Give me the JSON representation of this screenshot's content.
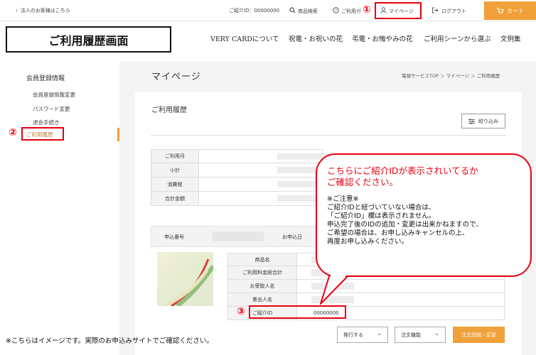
{
  "topbar": {
    "corp_link": "法人のお客様はこちら",
    "referral_id": "ご紹介ID：00000000",
    "search": "商品検索",
    "help": "ご利用ガ",
    "mypage": "マイページ",
    "logout": "ログアウト",
    "cart": "カート",
    "mark": "①"
  },
  "header": {
    "page_title": "ご利用履歴画面",
    "nav": [
      "VERY CARDについて",
      "祝電・お祝いの花",
      "弔電・お悔やみの花",
      "ご利用シーンから選ぶ",
      "文例集"
    ]
  },
  "sidebar": {
    "heading": "会員登録情報",
    "items": [
      {
        "label": "会員登録情報変更"
      },
      {
        "label": "パスワード変更"
      },
      {
        "label": "退会手続き"
      },
      {
        "label": "ご利用履歴"
      }
    ],
    "mark": "②"
  },
  "main": {
    "title": "マイページ",
    "breadcrumb": "電報サービスTOP ＞ マイページ ＞ ご利用履歴",
    "section_title": "ご利用履歴",
    "filter_button": "絞り込み",
    "summary_labels": [
      "ご利用月",
      "小計",
      "消費税",
      "合計金額"
    ],
    "order_no_label": "申込番号",
    "order_date_label": "お申込日",
    "detail_labels": [
      "商品名",
      "ご利用料金総合計",
      "お受取人名",
      "差出人名",
      "ご紹介ID"
    ],
    "referral_id_value": "00000000",
    "mark": "③",
    "ship_select": "発行する",
    "order_func_select": "注文機能",
    "order_button": "注文詳細・変更"
  },
  "callout": {
    "headline": [
      "こちらにご紹介IDが表示されいてるか",
      "ご確認ください。"
    ],
    "body": [
      "※ご注意※",
      "ご紹介IDと紐づいていない場合は、",
      "「ご紹介ID」欄は表示されません。",
      "申込完了後のIDの追加・変更は出来かねますので、",
      "ご希望の場合は、お申し込みキャンセルの上、",
      "再度お申し込みください。"
    ]
  },
  "footnote": "※こちらはイメージです。実際のお申込みサイトでご確認ください。",
  "colors": {
    "accent": "#f0a13a",
    "highlight": "#e60012"
  }
}
